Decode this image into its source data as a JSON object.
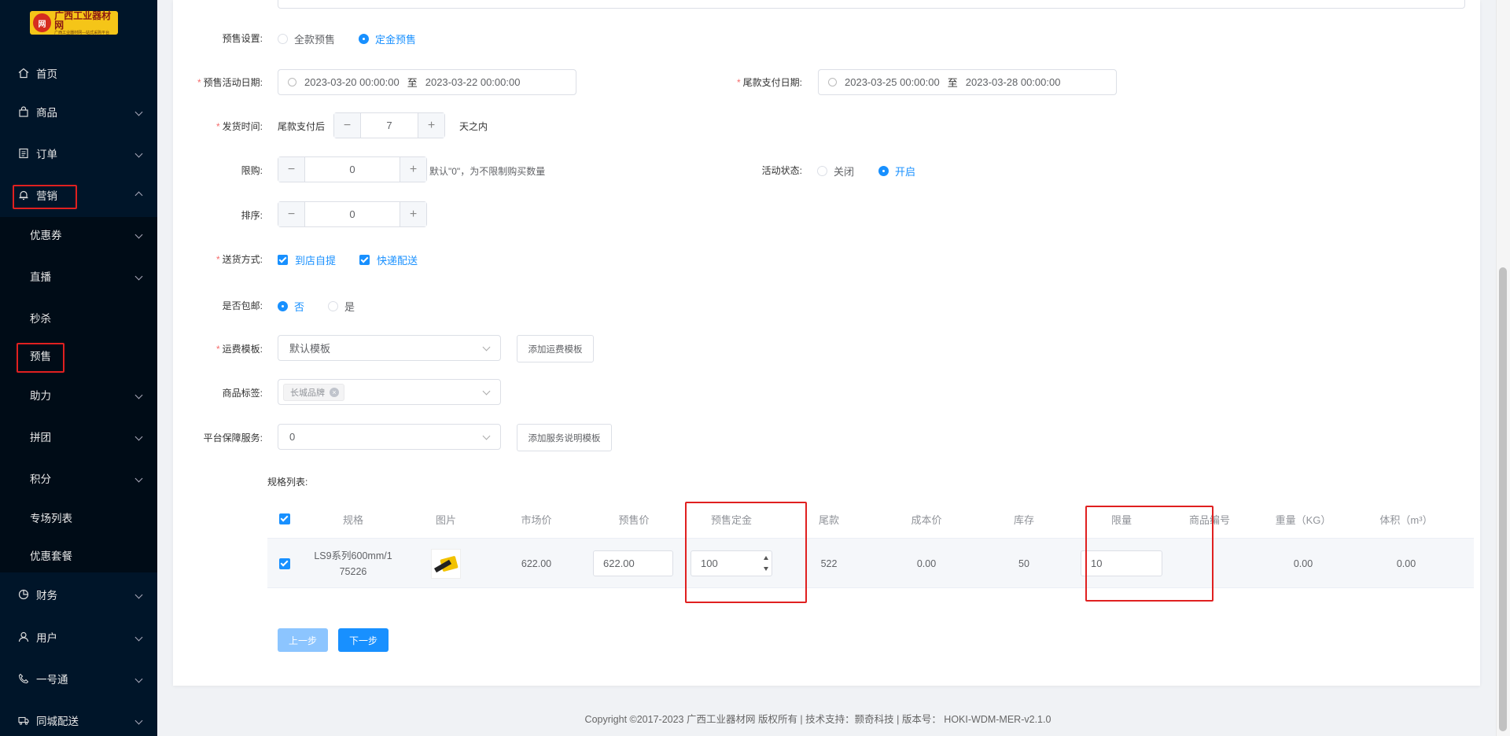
{
  "brand": {
    "name": "广西工业器材网",
    "tagline": "广西工业器材网—站式采购平台"
  },
  "sidebar": {
    "top_items": [
      {
        "label": "首页",
        "icon": "home-icon"
      },
      {
        "label": "商品",
        "icon": "shopping-bag-icon"
      },
      {
        "label": "订单",
        "icon": "order-doc-icon"
      },
      {
        "label": "营销",
        "icon": "bell-icon"
      }
    ],
    "marketing_sub": [
      {
        "label": "优惠券"
      },
      {
        "label": "直播"
      },
      {
        "label": "秒杀"
      },
      {
        "label": "预售"
      },
      {
        "label": "助力"
      },
      {
        "label": "拼团"
      },
      {
        "label": "积分"
      },
      {
        "label": "专场列表"
      },
      {
        "label": "优惠套餐"
      }
    ],
    "bottom_items": [
      {
        "label": "财务",
        "icon": "pie-chart-icon"
      },
      {
        "label": "用户",
        "icon": "user-icon"
      },
      {
        "label": "一号通",
        "icon": "phone-icon"
      },
      {
        "label": "同城配送",
        "icon": "truck-icon"
      }
    ]
  },
  "form": {
    "presale_setting_label": "预售设置:",
    "presale_options": [
      "全款预售",
      "定金预售"
    ],
    "activity_date_label": "预售活动日期:",
    "activity_start": "2023-03-20 00:00:00",
    "activity_end": "2023-03-22 00:00:00",
    "range_sep": "至",
    "balance_date_label": "尾款支付日期:",
    "balance_start": "2023-03-25 00:00:00",
    "balance_end": "2023-03-28 00:00:00",
    "ship_time_label": "发货时间:",
    "ship_prefix": "尾款支付后",
    "ship_days": "7",
    "ship_suffix": "天之内",
    "limit_label": "限购:",
    "limit_value": "0",
    "limit_hint": "默认\"0\"，为不限制购买数量",
    "status_label": "活动状态:",
    "status_options": [
      "关闭",
      "开启"
    ],
    "sort_label": "排序:",
    "sort_value": "0",
    "delivery_label": "送货方式:",
    "delivery_options": [
      "到店自提",
      "快递配送"
    ],
    "free_ship_label": "是否包邮:",
    "free_ship_options": [
      "否",
      "是"
    ],
    "freight_label": "运费模板:",
    "freight_value": "默认模板",
    "add_freight_btn": "添加运费模板",
    "tag_label": "商品标签:",
    "tag_value": "长城品牌",
    "guarantee_label": "平台保障服务:",
    "guarantee_value": "0",
    "add_guarantee_btn": "添加服务说明模板",
    "spec_list_label": "规格列表:"
  },
  "table": {
    "headers": [
      "规格",
      "图片",
      "市场价",
      "预售价",
      "预售定金",
      "尾款",
      "成本价",
      "库存",
      "限量",
      "商品编号",
      "重量（KG）",
      "体积（m³）"
    ],
    "row": {
      "spec_line1": "LS9系列600mm/1",
      "spec_line2": "75226",
      "market_price": "622.00",
      "presale_price": "622.00",
      "deposit": "100",
      "balance": "522",
      "cost": "0.00",
      "stock": "50",
      "limit": "10",
      "sku": "",
      "weight": "0.00",
      "volume": "0.00"
    }
  },
  "actions": {
    "prev": "上一步",
    "next": "下一步"
  },
  "footer": "Copyright ©2017-2023 广西工业器材网 版权所有 | 技术支持：颢奇科技 | 版本号：  HOKI-WDM-MER-v2.1.0",
  "colors": {
    "primary": "#1890ff",
    "sidebar_bg": "#001529",
    "highlight_box": "#e02020",
    "required": "#f56c6c"
  }
}
